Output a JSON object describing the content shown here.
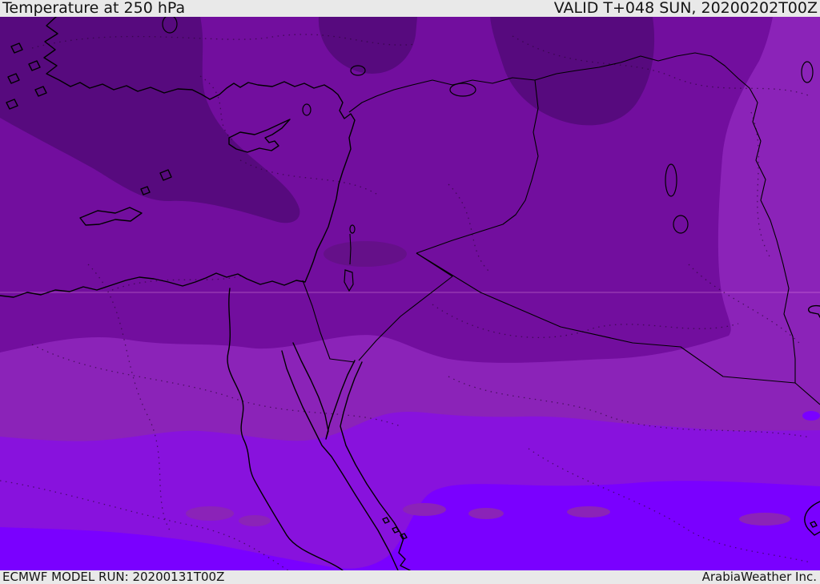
{
  "header": {
    "title": "Temperature at 250 hPa",
    "valid_label": "VALID T+048 SUN, 20200202T00Z"
  },
  "footer": {
    "model_run_label": "ECMWF MODEL RUN: 20200131T00Z",
    "credit_label": "ArabiaWeather Inc."
  },
  "map": {
    "description": "Temperature shading bands at 250 hPa over the Middle East, coldest (dark purple) north, warmer (bright violet) south",
    "colors": {
      "band_coldest": "#570a7e",
      "band_cold": "#720e9e",
      "band_mid": "#8b23b8",
      "band_warm": "#8812dd",
      "band_warmest": "#7a00ff",
      "band_cold_patch": "#651089",
      "contour_dots": "#2a0536",
      "bar_background": "#e9e9e9",
      "bar_text": "#141414",
      "coastline": "#000000"
    }
  }
}
